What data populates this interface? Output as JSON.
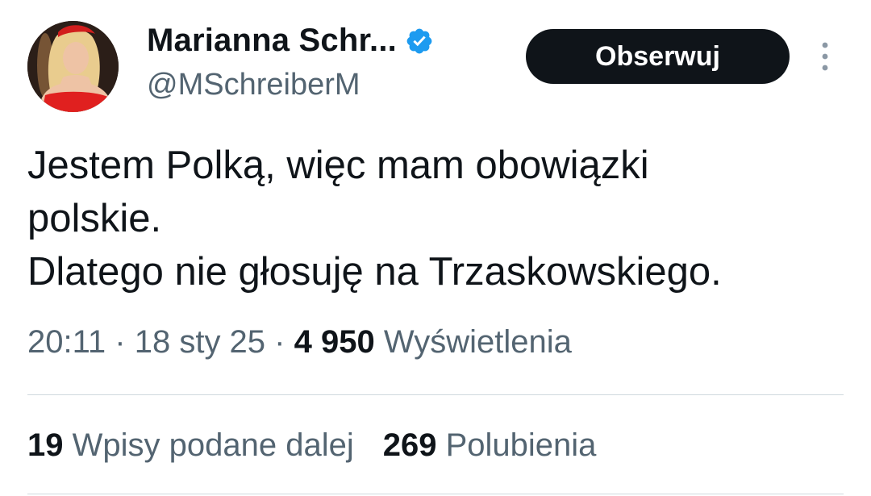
{
  "author": {
    "display_name": "Marianna Schr...",
    "handle": "@MSchreiberM",
    "verified": true
  },
  "follow_button": {
    "label": "Obserwuj"
  },
  "tweet": {
    "lines": [
      "Jestem Polką, więc mam obowiązki",
      "polskie.",
      "Dlatego nie głosuję na Trzaskowskiego."
    ]
  },
  "meta": {
    "time": "20:11",
    "separator": "·",
    "date": "18 sty 25",
    "views_count": "4 950",
    "views_label": "Wyświetlenia"
  },
  "stats": {
    "reposts_count": "19",
    "reposts_label": "Wpisy podane dalej",
    "likes_count": "269",
    "likes_label": "Polubienia"
  },
  "colors": {
    "text": "#0f1419",
    "secondary": "#536471",
    "verified": "#1d9bf0",
    "divider": "#cfd9de",
    "button_bg": "#0f1419"
  },
  "icons": {
    "verified": "verified-badge-icon",
    "more": "more-vertical-icon"
  }
}
